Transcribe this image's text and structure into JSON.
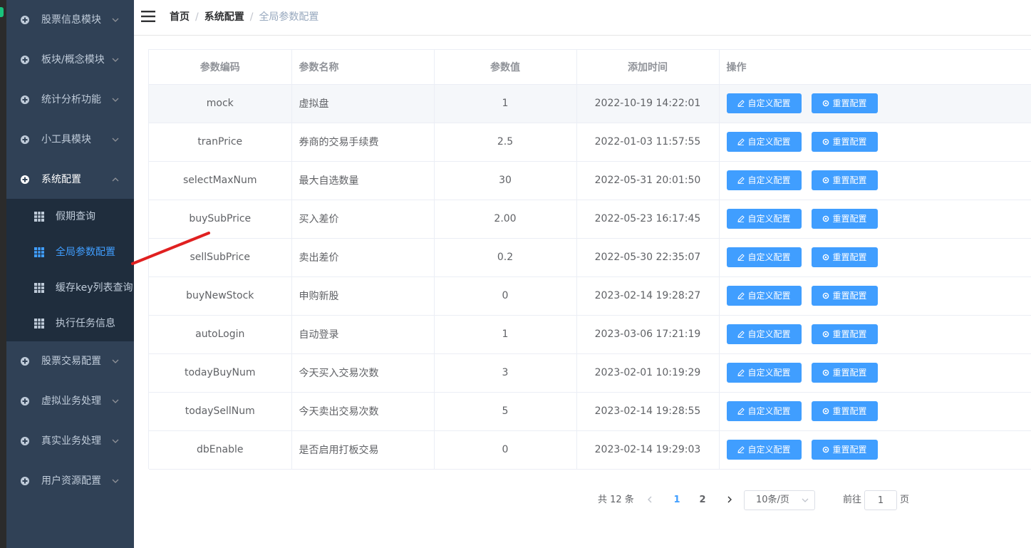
{
  "colors": {
    "sidebar_bg": "#304156",
    "submenu_bg": "#1f2d3d",
    "primary": "#409eff",
    "annotation_red": "#e02020"
  },
  "sidebar": {
    "menu_top": [
      {
        "label": "股票信息模块",
        "icon": "plus-circle-icon",
        "chevron": "chevron-down-icon"
      },
      {
        "label": "板块/概念模块",
        "icon": "plus-circle-icon",
        "chevron": "chevron-down-icon"
      },
      {
        "label": "统计分析功能",
        "icon": "plus-circle-icon",
        "chevron": "chevron-down-icon"
      },
      {
        "label": "小工具模块",
        "icon": "plus-circle-icon",
        "chevron": "chevron-down-icon"
      },
      {
        "label": "系统配置",
        "icon": "plus-circle-icon",
        "chevron": "chevron-up-icon",
        "expanded": true
      }
    ],
    "submenu": [
      {
        "label": "假期查询",
        "icon": "grid-icon",
        "active": false
      },
      {
        "label": "全局参数配置",
        "icon": "grid-icon",
        "active": true
      },
      {
        "label": "缓存key列表查询",
        "icon": "grid-icon",
        "active": false
      },
      {
        "label": "执行任务信息",
        "icon": "grid-icon",
        "active": false
      }
    ],
    "menu_bottom": [
      {
        "label": "股票交易配置",
        "icon": "plus-circle-icon",
        "chevron": "chevron-down-icon"
      },
      {
        "label": "虚拟业务处理",
        "icon": "plus-circle-icon",
        "chevron": "chevron-down-icon"
      },
      {
        "label": "真实业务处理",
        "icon": "plus-circle-icon",
        "chevron": "chevron-down-icon"
      },
      {
        "label": "用户资源配置",
        "icon": "plus-circle-icon",
        "chevron": "chevron-down-icon"
      }
    ]
  },
  "header": {
    "breadcrumb": [
      "首页",
      "系统配置",
      "全局参数配置"
    ],
    "separator": "/"
  },
  "table": {
    "columns": [
      "参数编码",
      "参数名称",
      "参数值",
      "添加时间",
      "操作"
    ],
    "edit_label": "自定义配置",
    "reset_label": "重置配置",
    "rows": [
      {
        "code": "mock",
        "name": "虚拟盘",
        "value": "1",
        "time": "2022-10-19 14:22:01"
      },
      {
        "code": "tranPrice",
        "name": "券商的交易手续费",
        "value": "2.5",
        "time": "2022-01-03 11:57:55"
      },
      {
        "code": "selectMaxNum",
        "name": "最大自选数量",
        "value": "30",
        "time": "2022-05-31 20:01:50"
      },
      {
        "code": "buySubPrice",
        "name": "买入差价",
        "value": "2.00",
        "time": "2022-05-23 16:17:45"
      },
      {
        "code": "sellSubPrice",
        "name": "卖出差价",
        "value": "0.2",
        "time": "2022-05-30 22:35:07"
      },
      {
        "code": "buyNewStock",
        "name": "申购新股",
        "value": "0",
        "time": "2023-02-14 19:28:27"
      },
      {
        "code": "autoLogin",
        "name": "自动登录",
        "value": "1",
        "time": "2023-03-06 17:21:19"
      },
      {
        "code": "todayBuyNum",
        "name": "今天买入交易次数",
        "value": "3",
        "time": "2023-02-01 10:19:29"
      },
      {
        "code": "todaySellNum",
        "name": "今天卖出交易次数",
        "value": "5",
        "time": "2023-02-14 19:28:55"
      },
      {
        "code": "dbEnable",
        "name": "是否启用打板交易",
        "value": "0",
        "time": "2023-02-14 19:29:03"
      }
    ]
  },
  "pagination": {
    "total_label": "共 12 条",
    "pages": [
      "1",
      "2"
    ],
    "current_page": "1",
    "page_size": "10条/页",
    "goto_prefix": "前往",
    "goto_value": "1",
    "goto_suffix": "页"
  }
}
